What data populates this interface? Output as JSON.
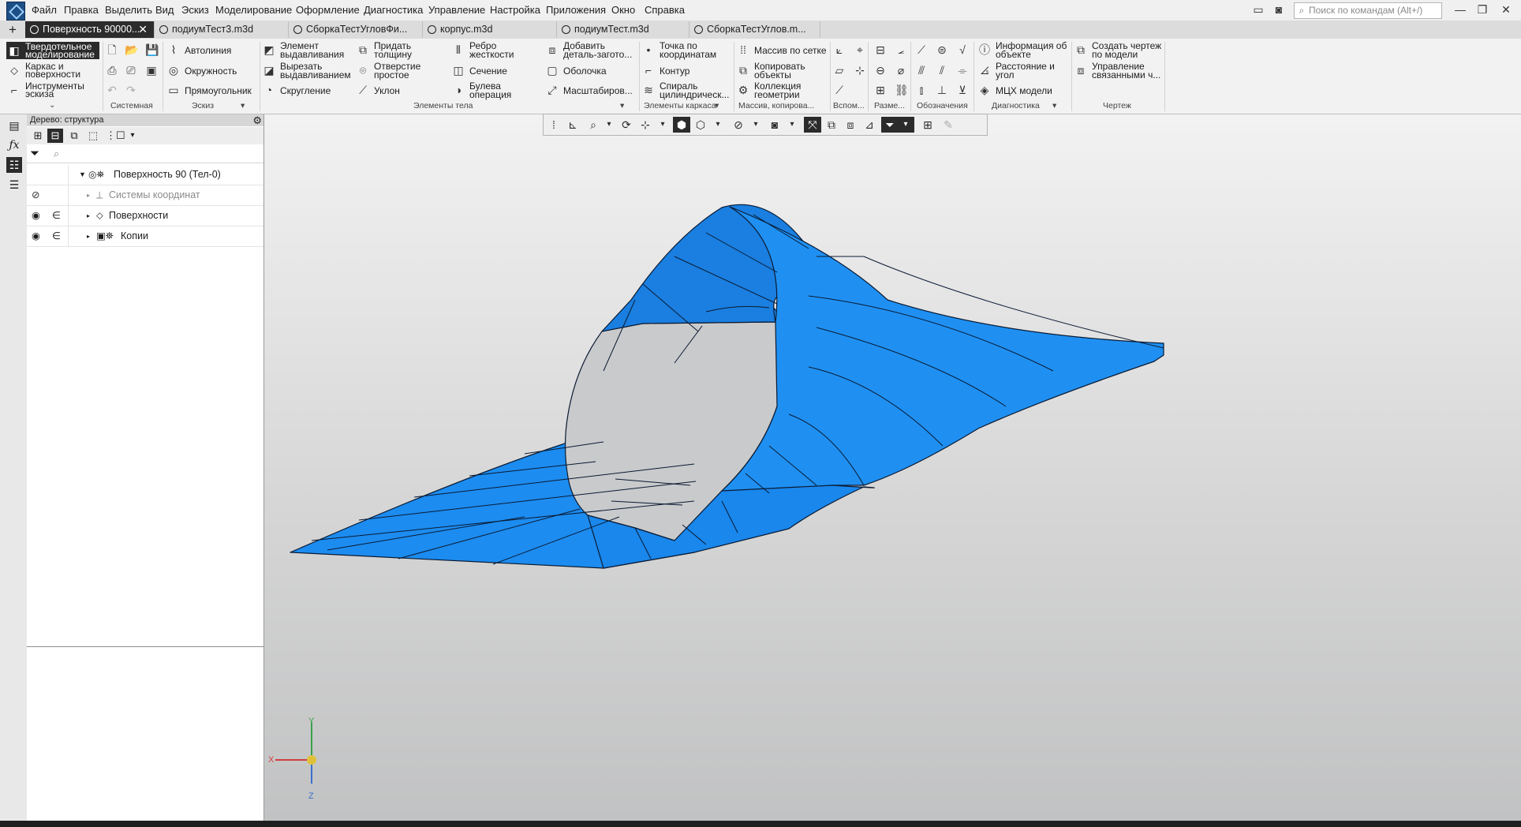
{
  "menu": [
    "Файл",
    "Правка",
    "Выделить",
    "Вид",
    "Эскиз",
    "Моделирование",
    "Оформление",
    "Диагностика",
    "Управление",
    "Настройка",
    "Приложения",
    "Окно",
    "Справка"
  ],
  "search": {
    "placeholder": "Поиск по командам (Alt+/)"
  },
  "tabs": [
    {
      "label": "Поверхность 90000...",
      "active": true
    },
    {
      "label": "подиумТест3.m3d"
    },
    {
      "label": "СборкаТестУгловФи..."
    },
    {
      "label": "корпус.m3d"
    },
    {
      "label": "подиумТест.m3d"
    },
    {
      "label": "СборкаТестУглов.m..."
    }
  ],
  "ribbon": {
    "modes": [
      {
        "l1": "Твердотельное",
        "l2": "моделирование",
        "active": true
      },
      {
        "l1": "Каркас и",
        "l2": "поверхности"
      },
      {
        "l1": "Инструменты",
        "l2": "эскиза"
      }
    ],
    "sketch": [
      "Автолиния",
      "Окружность",
      "Прямоугольник"
    ],
    "body": {
      "col1": [
        [
          "Элемент",
          "выдавливания"
        ],
        [
          "Вырезать",
          "выдавливанием"
        ],
        [
          "Скругление",
          ""
        ]
      ],
      "col2": [
        [
          "Придать",
          "толщину"
        ],
        [
          "Отверстие",
          "простое"
        ],
        [
          "Уклон",
          ""
        ]
      ],
      "col3": [
        [
          "Ребро",
          "жесткости"
        ],
        [
          "Сечение",
          ""
        ],
        [
          "Булева",
          "операция"
        ]
      ],
      "col4": [
        [
          "Добавить",
          "деталь-загото..."
        ],
        [
          "Оболочка",
          ""
        ],
        [
          "Масштабиров...",
          ""
        ]
      ]
    },
    "frame": [
      [
        "Точка по",
        "координатам"
      ],
      [
        "Контур",
        ""
      ],
      [
        "Спираль",
        "цилиндрическ..."
      ]
    ],
    "array": [
      [
        "Массив по сетке",
        ""
      ],
      [
        "Копировать",
        "объекты"
      ],
      [
        "Коллекция",
        "геометрии"
      ]
    ],
    "diag": [
      [
        "Информация об",
        "объекте"
      ],
      [
        "Расстояние и",
        "угол"
      ],
      [
        "МЦХ модели",
        ""
      ]
    ],
    "drawing": [
      [
        "Создать чертеж",
        "по модели"
      ],
      [
        "Управление",
        "связанными ч..."
      ]
    ],
    "groups": [
      "Системная",
      "Эскиз",
      "Элементы тела",
      "Элементы каркаса",
      "Массив, копирова...",
      "Вспом...",
      "Разме...",
      "Обозначения",
      "Диагностика",
      "Чертеж"
    ]
  },
  "tree": {
    "title": "Дерево: структура",
    "root": "Поверхность 90 (Тел-0)",
    "items": [
      "Системы координат",
      "Поверхности",
      "Копии"
    ]
  },
  "triad": {
    "x": "X",
    "y": "Y",
    "z": "Z"
  },
  "colors": {
    "surface": "#1f8ce6",
    "edge": "#0a1a33",
    "accent": "#2b2b2b"
  }
}
